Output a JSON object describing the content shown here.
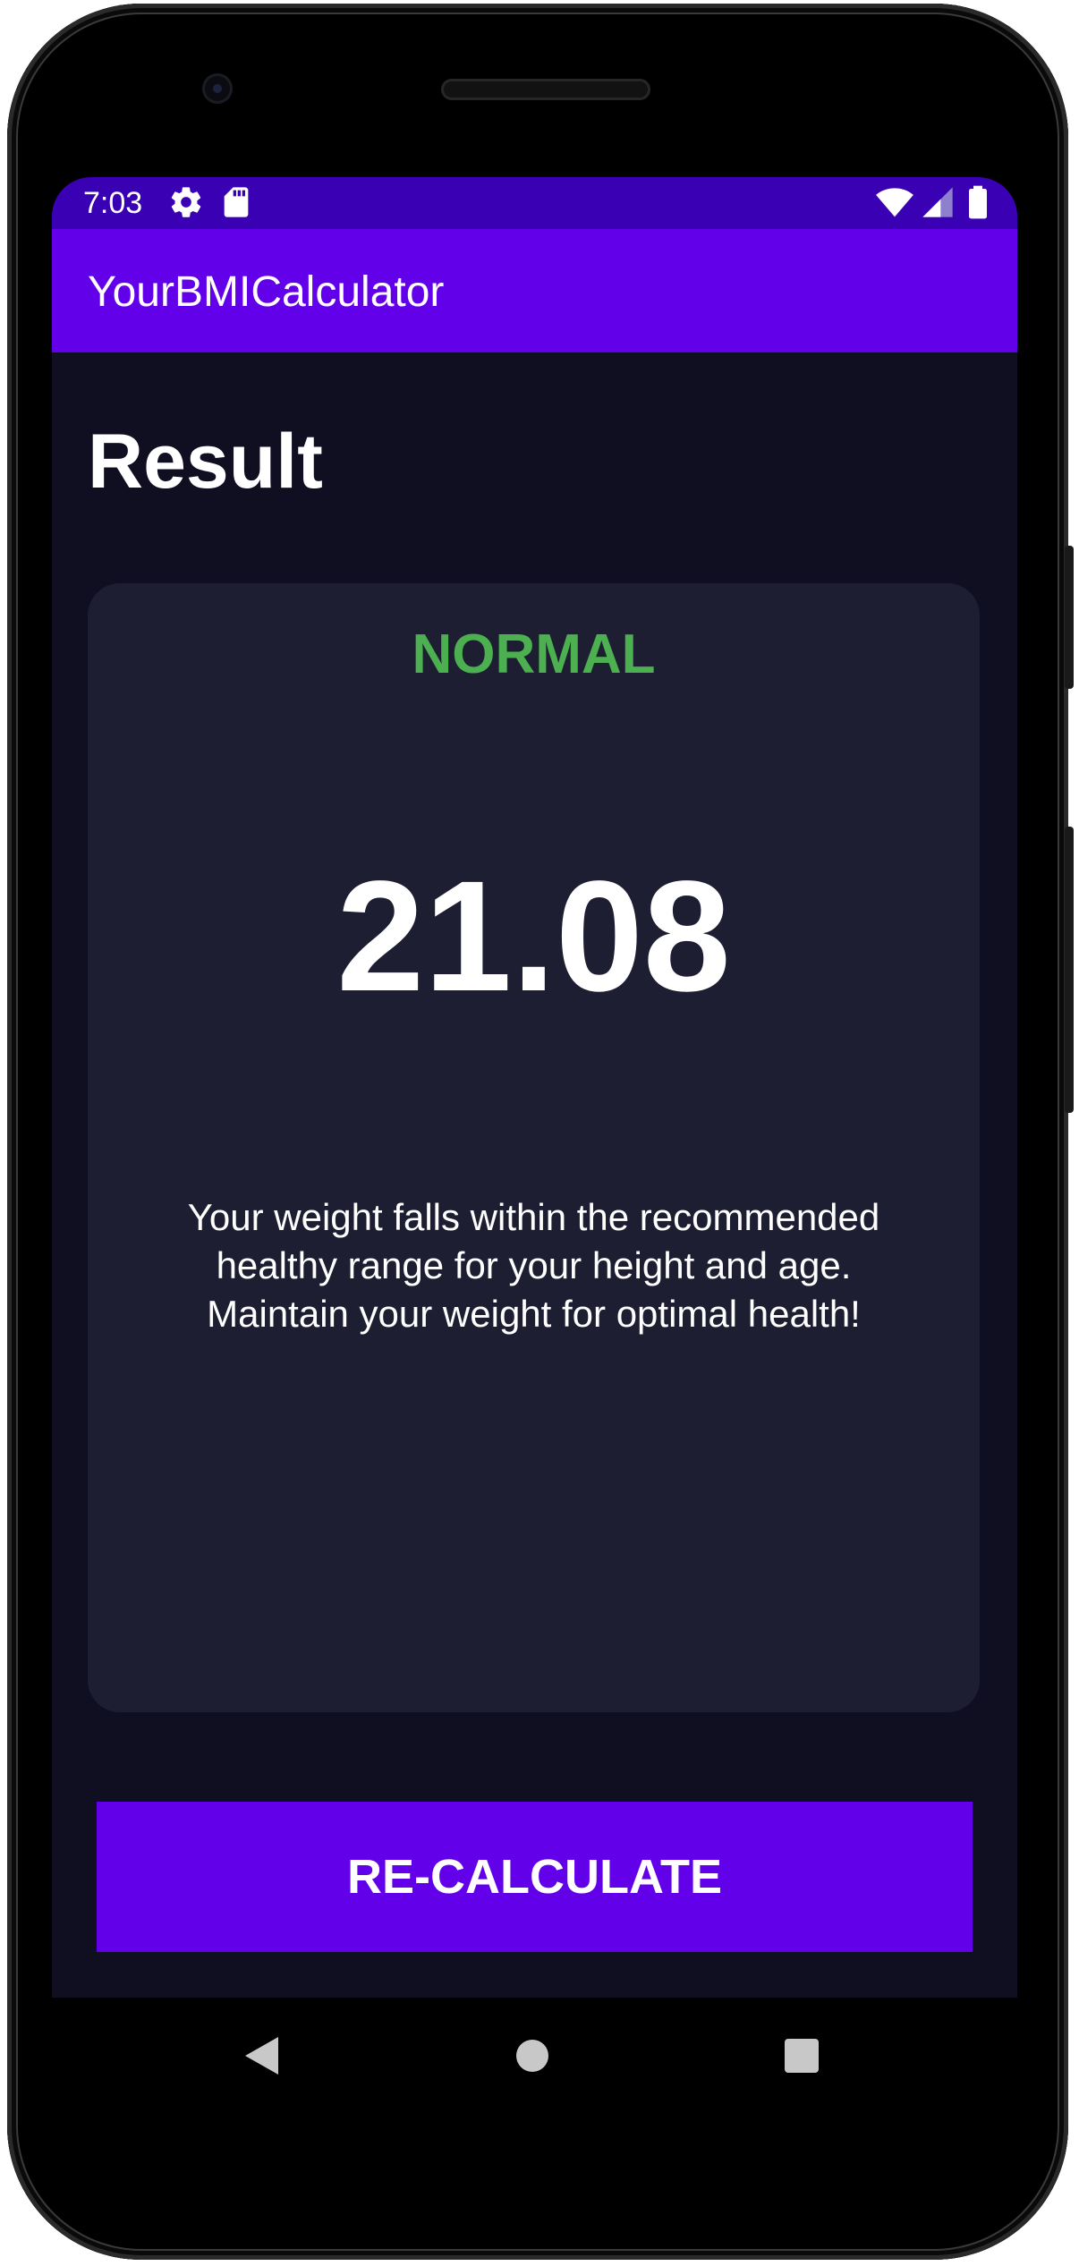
{
  "status_bar": {
    "time": "7:03",
    "icons": [
      "settings-gear-icon",
      "sd-card-icon",
      "wifi-icon",
      "cellular-signal-icon",
      "battery-icon"
    ],
    "background_color": "#3a00b4"
  },
  "app_bar": {
    "title": "YourBMICalculator",
    "background_color": "#6200ea"
  },
  "page": {
    "title": "Result",
    "background_color": "#100e21"
  },
  "result_card": {
    "status": "NORMAL",
    "status_color": "#4caf50",
    "bmi_value": "21.08",
    "message": "Your weight falls within the recommended healthy range for your height and age. Maintain your weight for optimal health!",
    "background_color": "#1e1e33"
  },
  "recalculate_button": {
    "label": "RE-CALCULATE",
    "background_color": "#6200ea"
  },
  "nav_bar": {
    "icons": [
      "back-triangle-icon",
      "home-circle-icon",
      "recents-square-icon"
    ]
  }
}
